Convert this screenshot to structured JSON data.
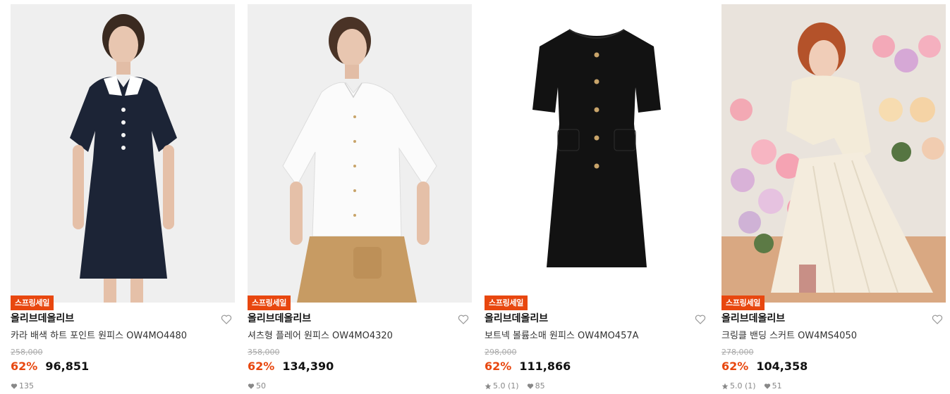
{
  "colors": {
    "accent": "#e8470f",
    "text": "#111111",
    "muted": "#888888"
  },
  "products": [
    {
      "badge": "스프링세일",
      "brand": "올리브데올리브",
      "name": "카라 배색 하트 포인트 원피스 OW4MO4480",
      "original_price": "258,000",
      "discount": "62%",
      "price": "96,851",
      "rating": "",
      "likes": "135",
      "image": "navy-collared-dress"
    },
    {
      "badge": "스프링세일",
      "brand": "올리브데올리브",
      "name": "셔츠형 플레어 원피스 OW4MO4320",
      "original_price": "358,000",
      "discount": "62%",
      "price": "134,390",
      "rating": "",
      "likes": "50",
      "image": "white-shirt-beige-skirt"
    },
    {
      "badge": "스프링세일",
      "brand": "올리브데올리브",
      "name": "보트넥 볼륨소매 원피스 OW4MO457A",
      "original_price": "298,000",
      "discount": "62%",
      "price": "111,866",
      "rating": "5.0 (1)",
      "likes": "85",
      "image": "black-button-dress"
    },
    {
      "badge": "스프링세일",
      "brand": "올리브데올리브",
      "name": "크링클 밴딩 스커트 OW4MS4050",
      "original_price": "278,000",
      "discount": "62%",
      "price": "104,358",
      "rating": "5.0 (1)",
      "likes": "51",
      "image": "cream-pleated-skirt-roses"
    }
  ]
}
